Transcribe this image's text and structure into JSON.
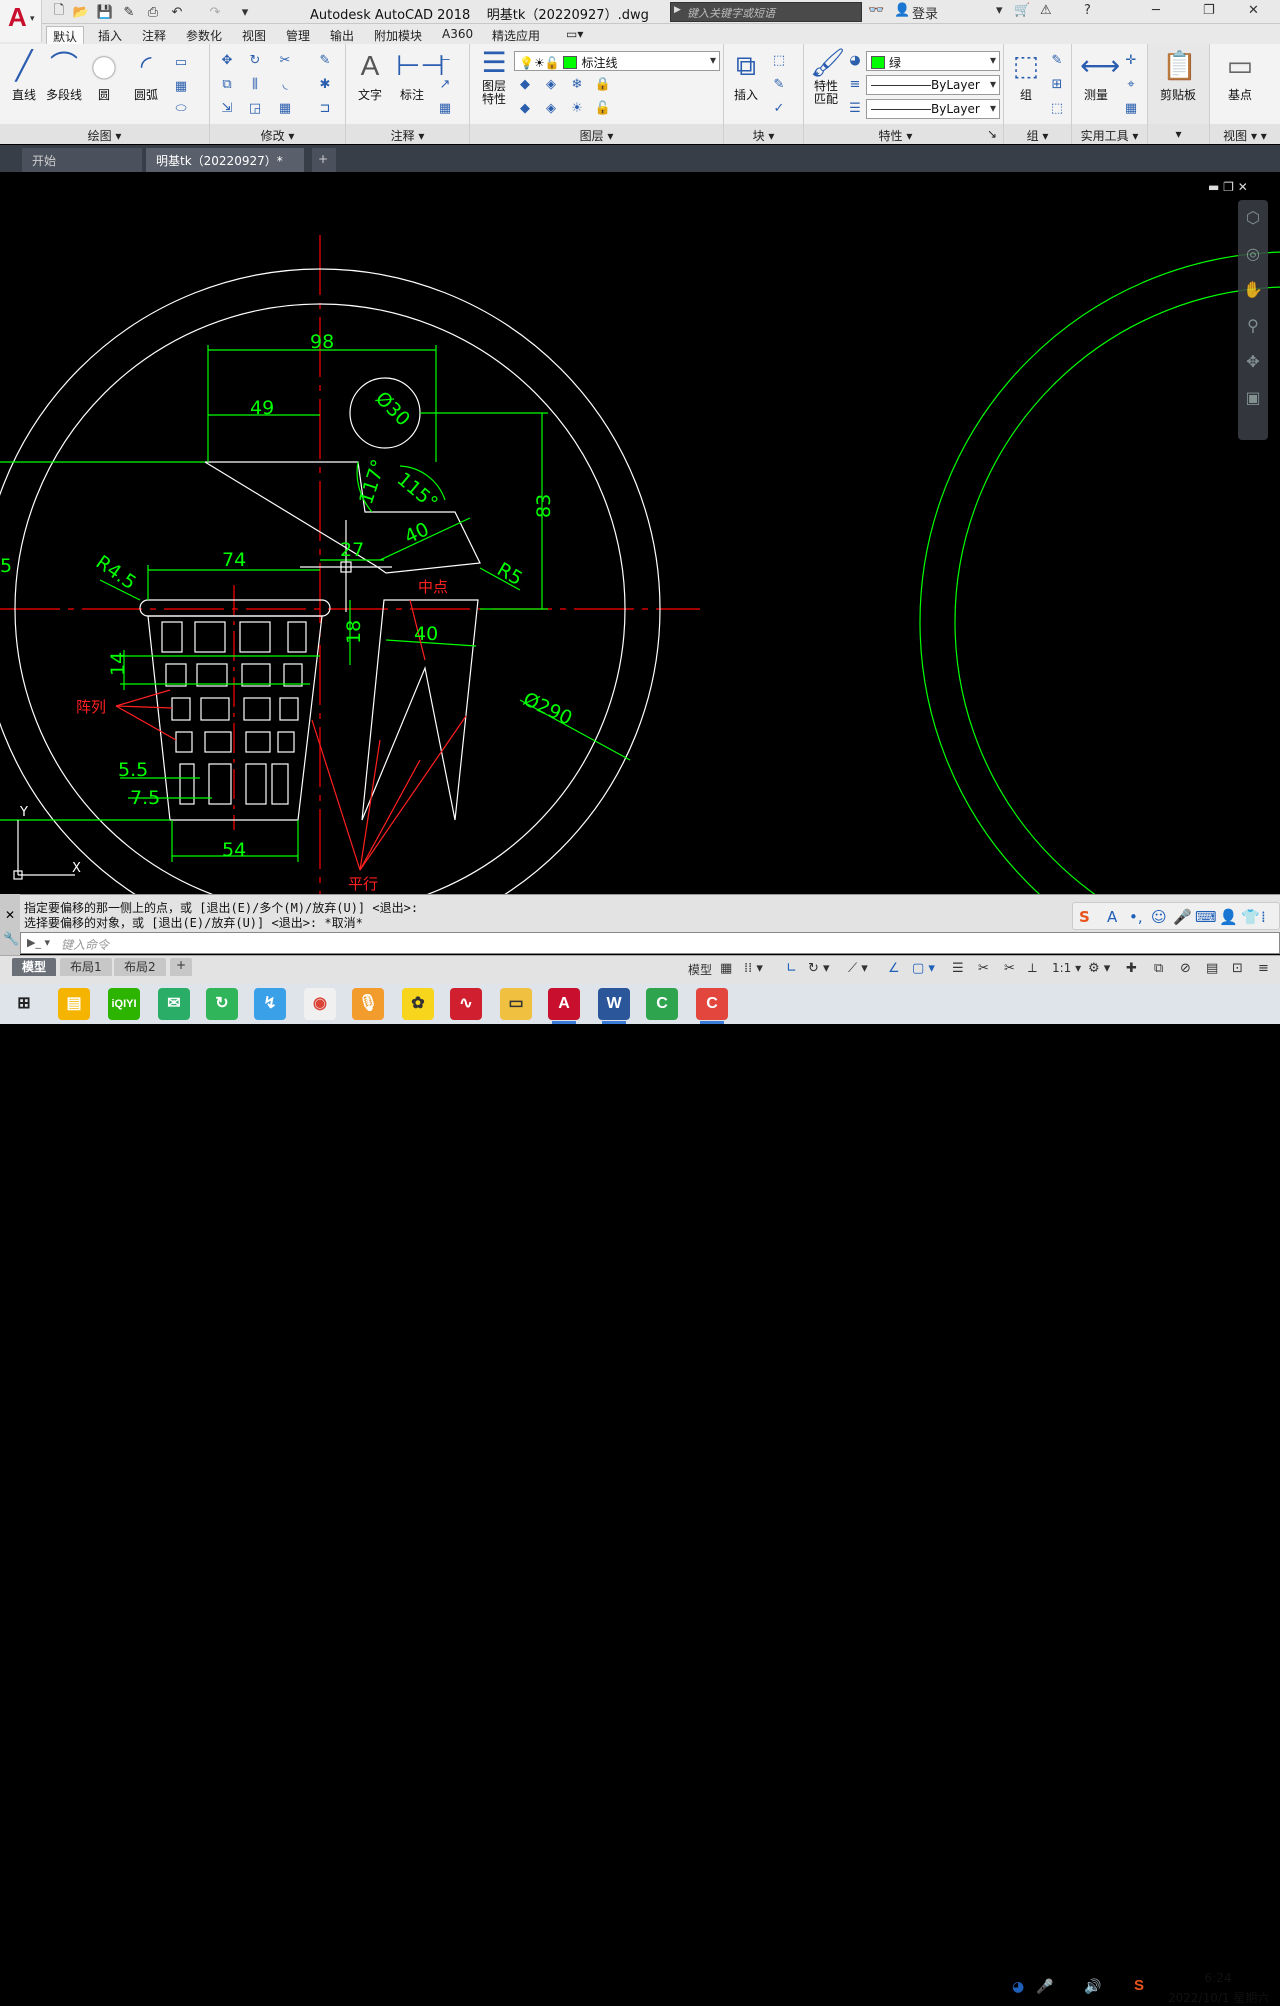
{
  "window": {
    "title": "Autodesk AutoCAD 2018",
    "filename": "明基tk（20220927）.dwg",
    "search_placeholder": "键入关键字或短语",
    "login": "登录",
    "help": "?"
  },
  "ribbon_tabs": [
    "默认",
    "插入",
    "注释",
    "参数化",
    "视图",
    "管理",
    "输出",
    "附加模块",
    "A360",
    "精选应用"
  ],
  "active_tab": "默认",
  "panels": {
    "draw": {
      "title": "绘图",
      "line": "直线",
      "polyline": "多段线",
      "circle": "圆",
      "arc": "圆弧"
    },
    "modify": {
      "title": "修改"
    },
    "annotation": {
      "title": "注释",
      "text": "文字",
      "dimension": "标注"
    },
    "layers": {
      "title": "图层",
      "layer_props": "图层\n特性",
      "current_layer": "标注线"
    },
    "block": {
      "title": "块",
      "insert": "插入"
    },
    "properties": {
      "title": "特性",
      "match": "特性\n匹配",
      "color": "绿",
      "linetype": "ByLayer",
      "lineweight": "ByLayer"
    },
    "groups": {
      "title": "组",
      "group": "组"
    },
    "utilities": {
      "title": "实用工具",
      "measure": "测量"
    },
    "clipboard": {
      "title": "",
      "paste": "剪贴板"
    },
    "view": {
      "title": "视图",
      "base": "基点"
    }
  },
  "doc_tabs": [
    "开始",
    "明基tk（20220927）*"
  ],
  "drawing": {
    "dims": [
      "98",
      "49",
      "Ø30",
      "83",
      "117°",
      "115°",
      "40",
      "27",
      "74",
      "R4.5",
      "R5",
      "中点",
      "18",
      "40",
      "14",
      "阵列",
      "5.5",
      "7.5",
      "54",
      "Ø290",
      "平行",
      "5"
    ],
    "colors": {
      "dim": "#00ff00",
      "geom": "#ffffff",
      "center": "#ff0000",
      "annot_red": "#ff2020"
    }
  },
  "command": {
    "line1": "指定要偏移的那一侧上的点，或 [退出(E)/多个(M)/放弃(U)] <退出>:",
    "line2": "选择要偏移的对象，或 [退出(E)/放弃(U)] <退出>:  *取消*",
    "placeholder": "键入命令"
  },
  "layout_tabs": [
    "模型",
    "布局1",
    "布局2"
  ],
  "status": {
    "model": "模型",
    "scale": "1:1"
  },
  "taskbar": {
    "time": "6:24",
    "date": "2022/10/1 星期六"
  }
}
